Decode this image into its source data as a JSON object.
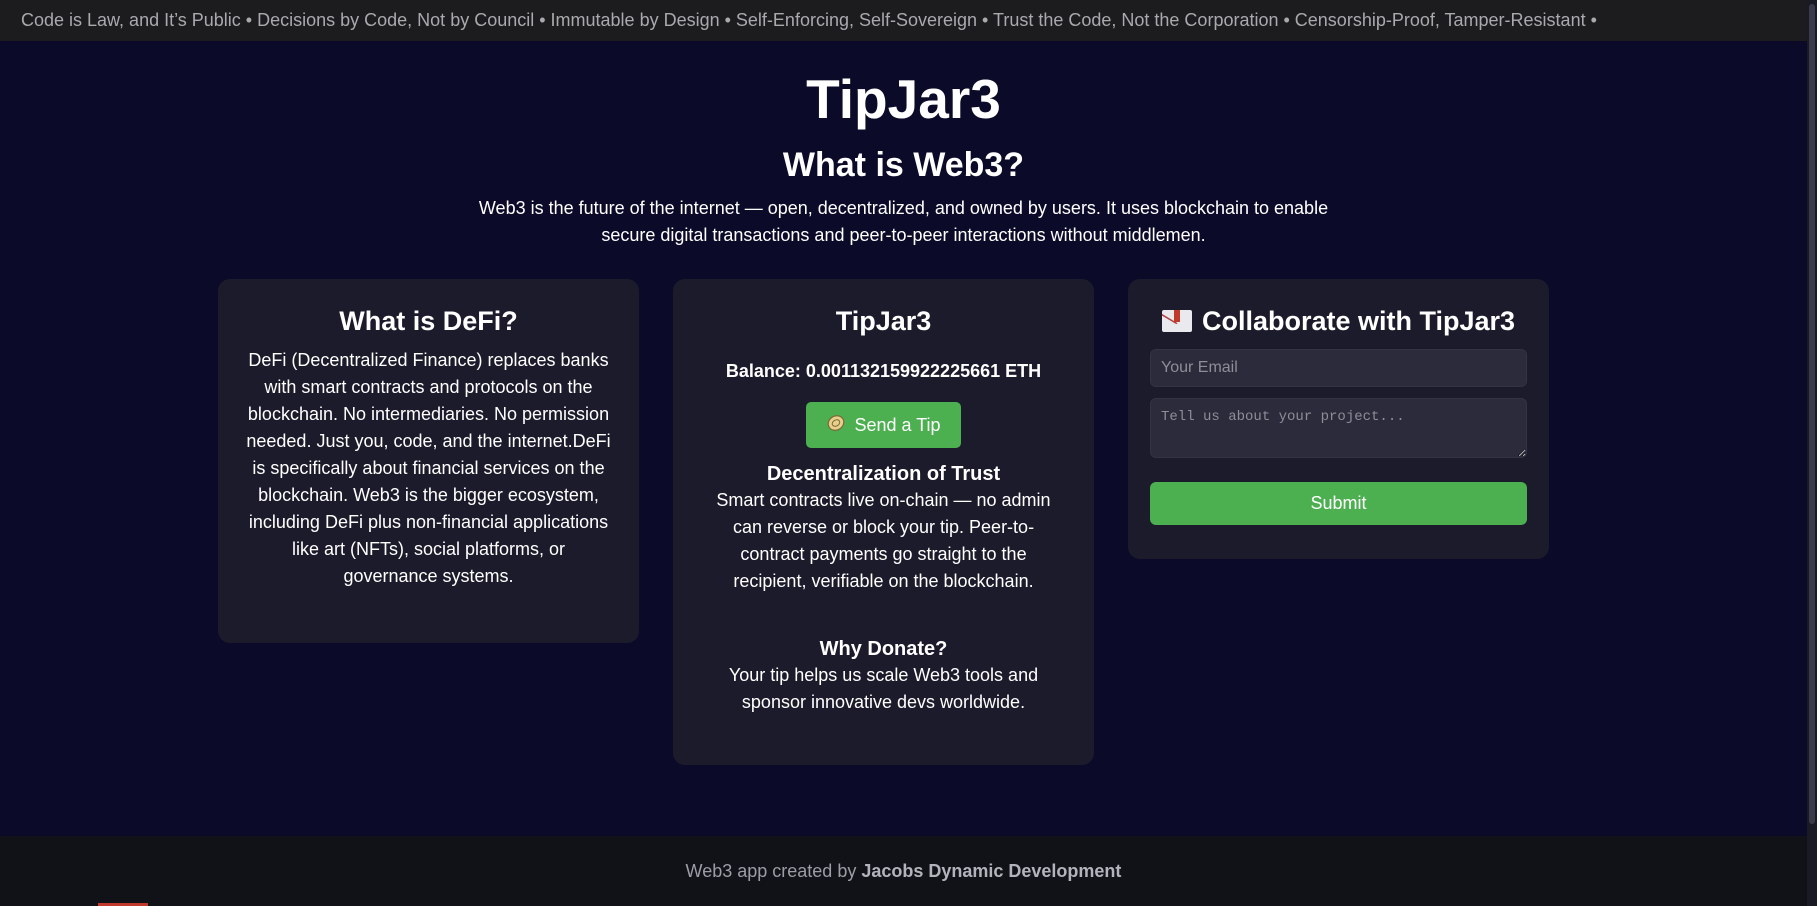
{
  "ticker": {
    "text": "Code is Law, and It’s Public • Decisions by Code, Not by Council • Immutable by Design • Self-Enforcing, Self-Sovereign • Trust the Code, Not the Corporation • Censorship-Proof, Tamper-Resistant •"
  },
  "hero": {
    "title": "TipJar3",
    "heading": "What is Web3?",
    "text": "Web3 is the future of the internet — open, decentralized, and owned by users. It uses blockchain to enable secure digital transactions and peer-to-peer interactions without middlemen."
  },
  "defi_card": {
    "heading": "What is DeFi?",
    "text": "DeFi (Decentralized Finance) replaces banks with smart contracts and protocols on the blockchain. No intermediaries. No permission needed. Just you, code, and the internet.DeFi is specifically about financial services on the blockchain. Web3 is the bigger ecosystem, including DeFi plus non-financial applications like art (NFTs), social platforms, or governance systems."
  },
  "tip_card": {
    "heading": "TipJar3",
    "balance": "Balance: 0.001132159922225661 ETH",
    "button_label": "Send a Tip",
    "button_icon": "coin-icon",
    "trust_heading": "Decentralization of Trust",
    "trust_text": "Smart contracts live on-chain — no admin can reverse or block your tip. Peer-to-contract payments go straight to the recipient, verifiable on the blockchain.",
    "donate_heading": "Why Donate?",
    "donate_text": "Your tip helps us scale Web3 tools and sponsor innovative devs worldwide."
  },
  "collab_card": {
    "icon": "envelope-icon",
    "heading": "Collaborate with TipJar3",
    "email_placeholder": "Your Email",
    "project_placeholder": "Tell us about your project...",
    "submit_label": "Submit"
  },
  "footer": {
    "prefix": "Web3 app created by ",
    "author": "Jacobs Dynamic Development"
  },
  "colors": {
    "background": "#0b0b29",
    "card": "#1b1b2b",
    "accent": "#4caf50",
    "ticker_bg": "#1c1c1e",
    "footer_bg": "#111118"
  }
}
